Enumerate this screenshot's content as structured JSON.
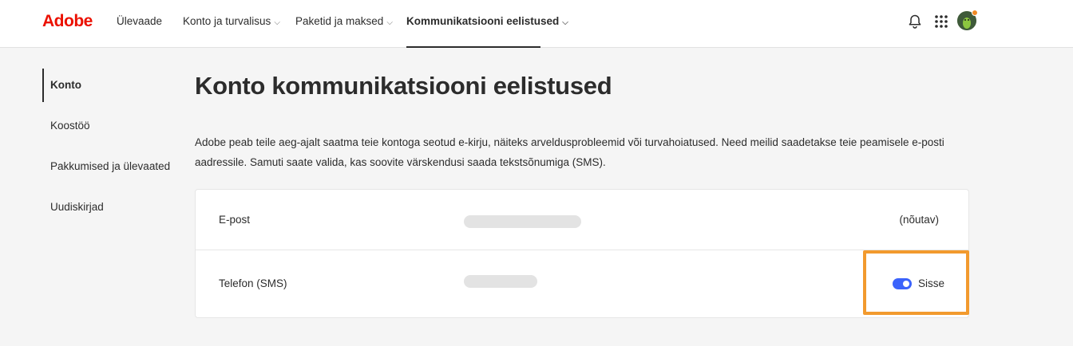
{
  "topnav": {
    "logo": "Adobe",
    "items": [
      {
        "label": "Ülevaade",
        "chevron": ""
      },
      {
        "label": "Konto ja turvalisus",
        "chevron": "⌵"
      },
      {
        "label": "Paketid ja maksed",
        "chevron": "⌵"
      },
      {
        "label": "Kommunikatsiooni eelistused",
        "chevron": "⌵"
      }
    ],
    "icons": [
      "bell-icon",
      "apps-grid-icon",
      "avatar"
    ]
  },
  "sidebar": {
    "items": [
      {
        "label": "Konto"
      },
      {
        "label": "Koostöö"
      },
      {
        "label": "Pakkumised ja ülevaated"
      },
      {
        "label": "Uudiskirjad"
      }
    ]
  },
  "main": {
    "title": "Konto kommunikatsiooni eelistused",
    "description": "Adobe peab teile aeg-ajalt saatma teie kontoga seotud e-kirju, näiteks arveldusprobleemid või turvahoiatused. Need meilid saadetakse teie peamisele e-posti aadressile. Samuti saate valida, kas soovite värskendusi saada tekstsõnumiga (SMS).",
    "rows": [
      {
        "label": "E-post",
        "status": "(nõutav)"
      },
      {
        "label": "Telefon (SMS)",
        "toggle_label": "Sisse",
        "toggle_on": true
      }
    ]
  },
  "colors": {
    "brand": "#eb1000",
    "toggle_on": "#3b63fb",
    "highlight": "#f29a2e"
  }
}
